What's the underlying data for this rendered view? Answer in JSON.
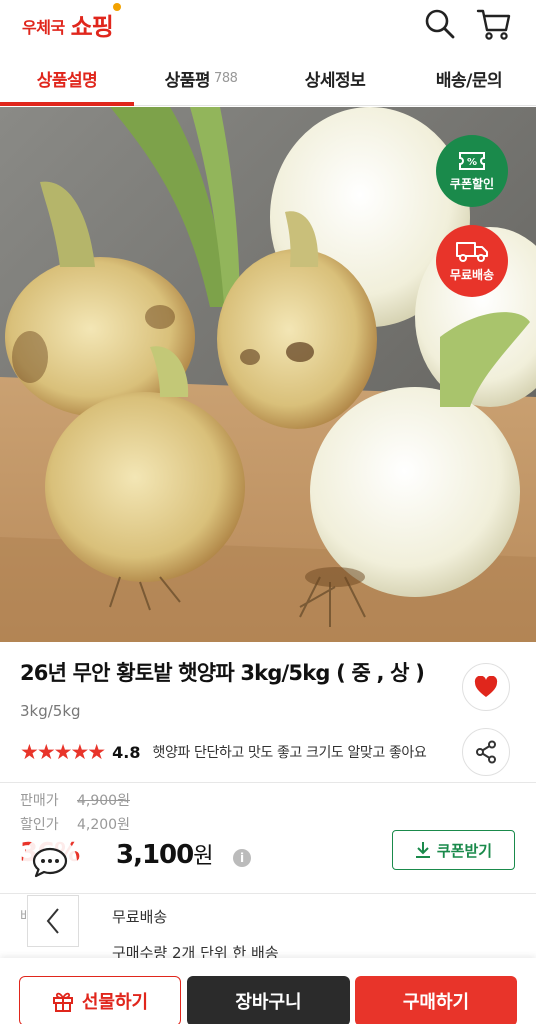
{
  "header": {
    "logo_small": "우체국",
    "logo_big": "쇼핑"
  },
  "tabs": [
    {
      "label": "상품설명",
      "count": ""
    },
    {
      "label": "상품평",
      "count": "788"
    },
    {
      "label": "상세정보",
      "count": ""
    },
    {
      "label": "배송/문의",
      "count": ""
    }
  ],
  "badges": {
    "coupon": "쿠폰할인",
    "shipping": "무료배송"
  },
  "product": {
    "title": "26년 무안 황토밭 햇양파 3kg/5kg ( 중 , 상 )",
    "option": "3kg/5kg",
    "stars": "★★★★★",
    "rating": "4.8",
    "review": "햇양파 단단하고 맛도 좋고 크기도 알맞고 좋아요"
  },
  "price": {
    "sale_label": "판매가",
    "sale_value": "4,900원",
    "discount_label": "할인가",
    "discount_value": "4,200원",
    "discount_rate": "36%",
    "final_value": "3,100",
    "final_unit": "원",
    "info_icon": "i",
    "coupon_button": "쿠폰받기"
  },
  "shipping": {
    "label": "배송",
    "value": "무료배송",
    "note": "구매수량 2개 단위 한 배송"
  },
  "bottom_bar": {
    "gift": "선물하기",
    "cart": "장바구니",
    "buy": "구매하기"
  },
  "colors": {
    "accent_red": "#e0261c",
    "coupon_green": "#1a8a4b",
    "dark": "#2b2b2b"
  }
}
